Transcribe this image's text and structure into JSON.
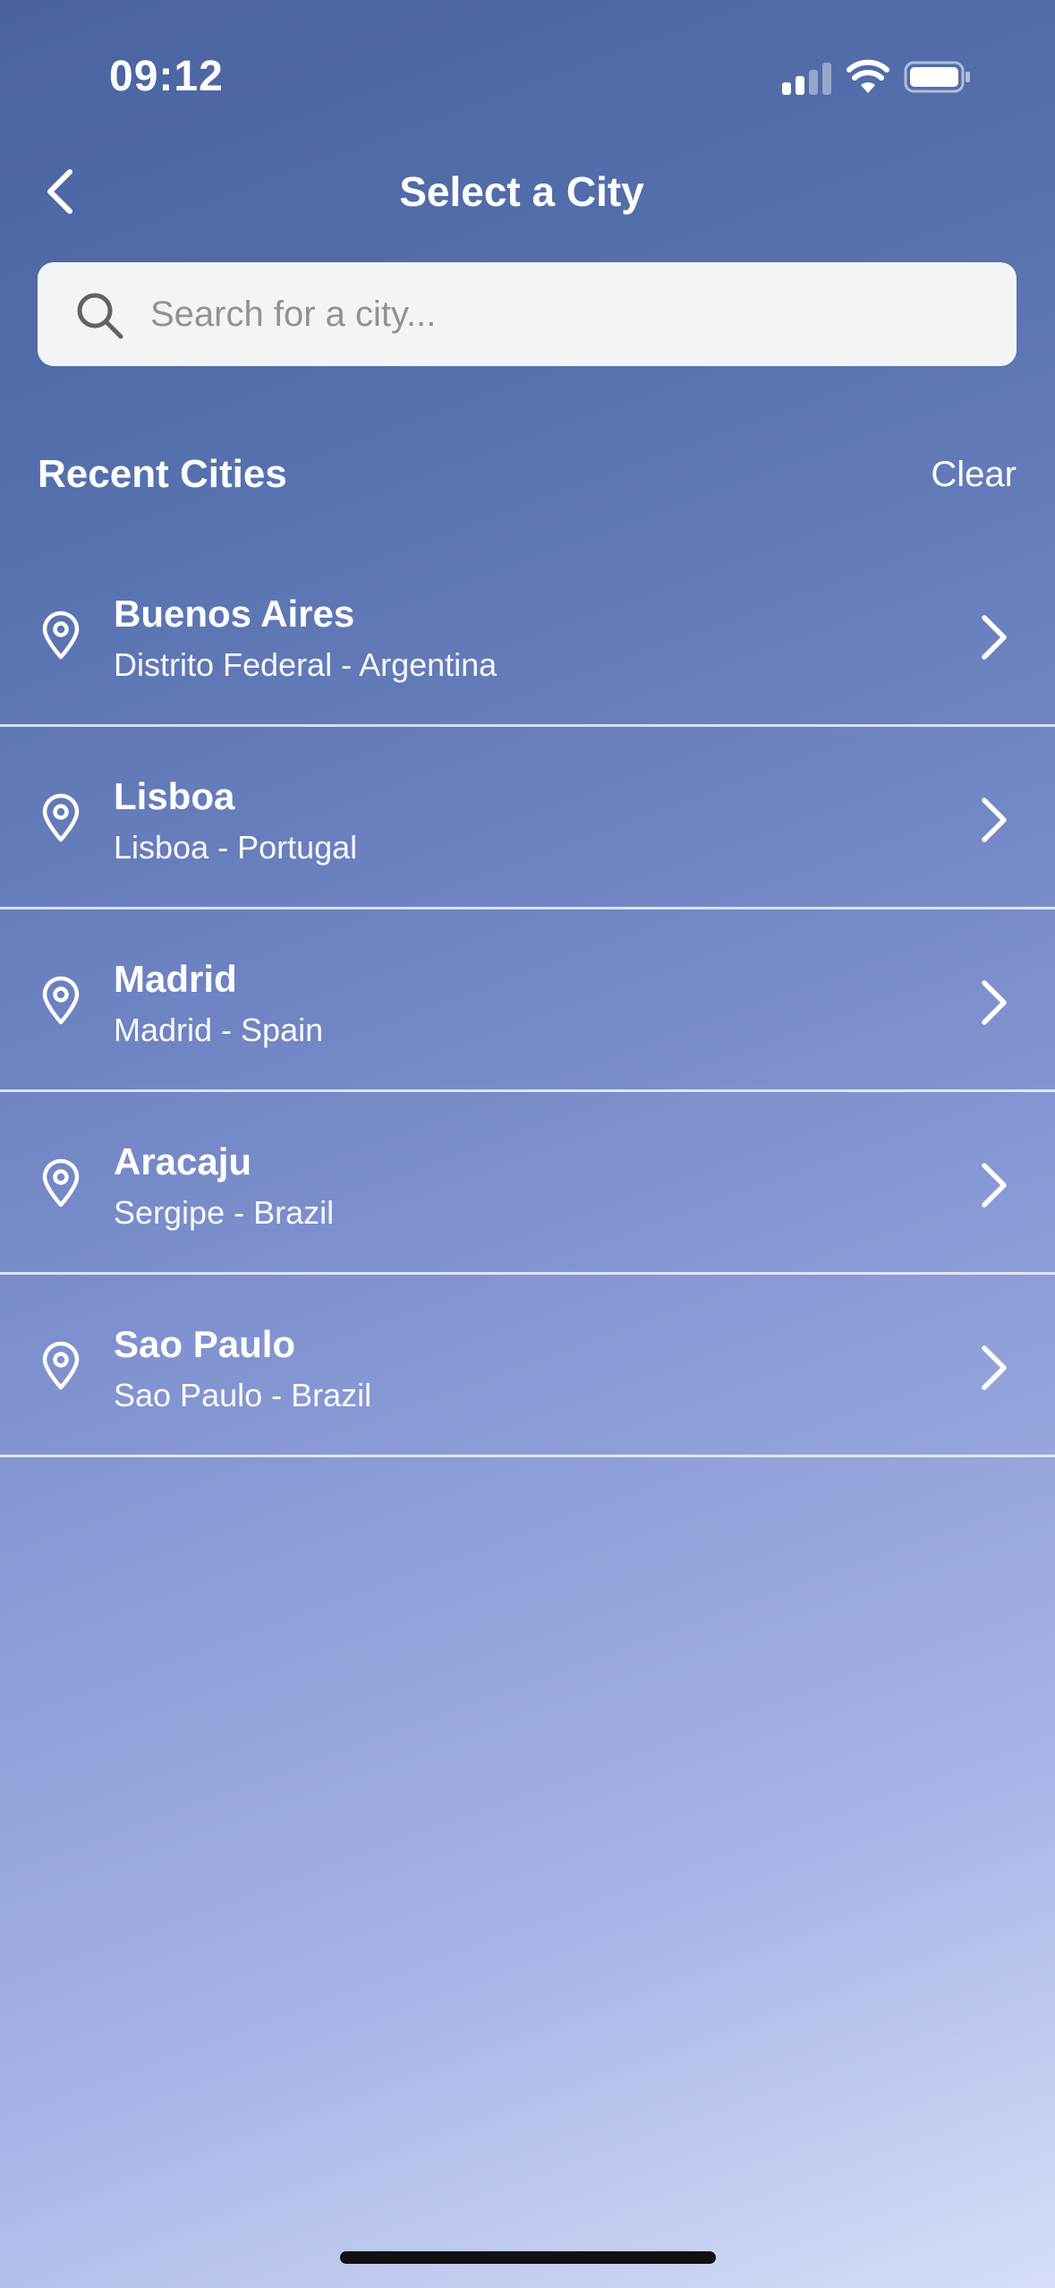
{
  "status_bar": {
    "time": "09:12",
    "icons": [
      "cellular-signal-icon",
      "wifi-icon",
      "battery-icon"
    ]
  },
  "header": {
    "back_icon": "chevron-left-icon",
    "title": "Select a City"
  },
  "search": {
    "icon": "search-icon",
    "value": "",
    "placeholder": "Search for a city..."
  },
  "recent": {
    "title": "Recent Cities",
    "clear_label": "Clear",
    "items": [
      {
        "name": "Buenos Aires",
        "region": "Distrito Federal - Argentina"
      },
      {
        "name": "Lisboa",
        "region": "Lisboa - Portugal"
      },
      {
        "name": "Madrid",
        "region": "Madrid - Spain"
      },
      {
        "name": "Aracaju",
        "region": "Sergipe - Brazil"
      },
      {
        "name": "Sao Paulo",
        "region": "Sao Paulo - Brazil"
      }
    ],
    "item_icon": "location-pin-icon",
    "trailing_icon": "chevron-right-icon"
  },
  "colors": {
    "gradient_top": "#4a62a0",
    "gradient_bottom": "#d6def8",
    "search_bg": "#f3f4f5",
    "text": "#ffffff"
  }
}
